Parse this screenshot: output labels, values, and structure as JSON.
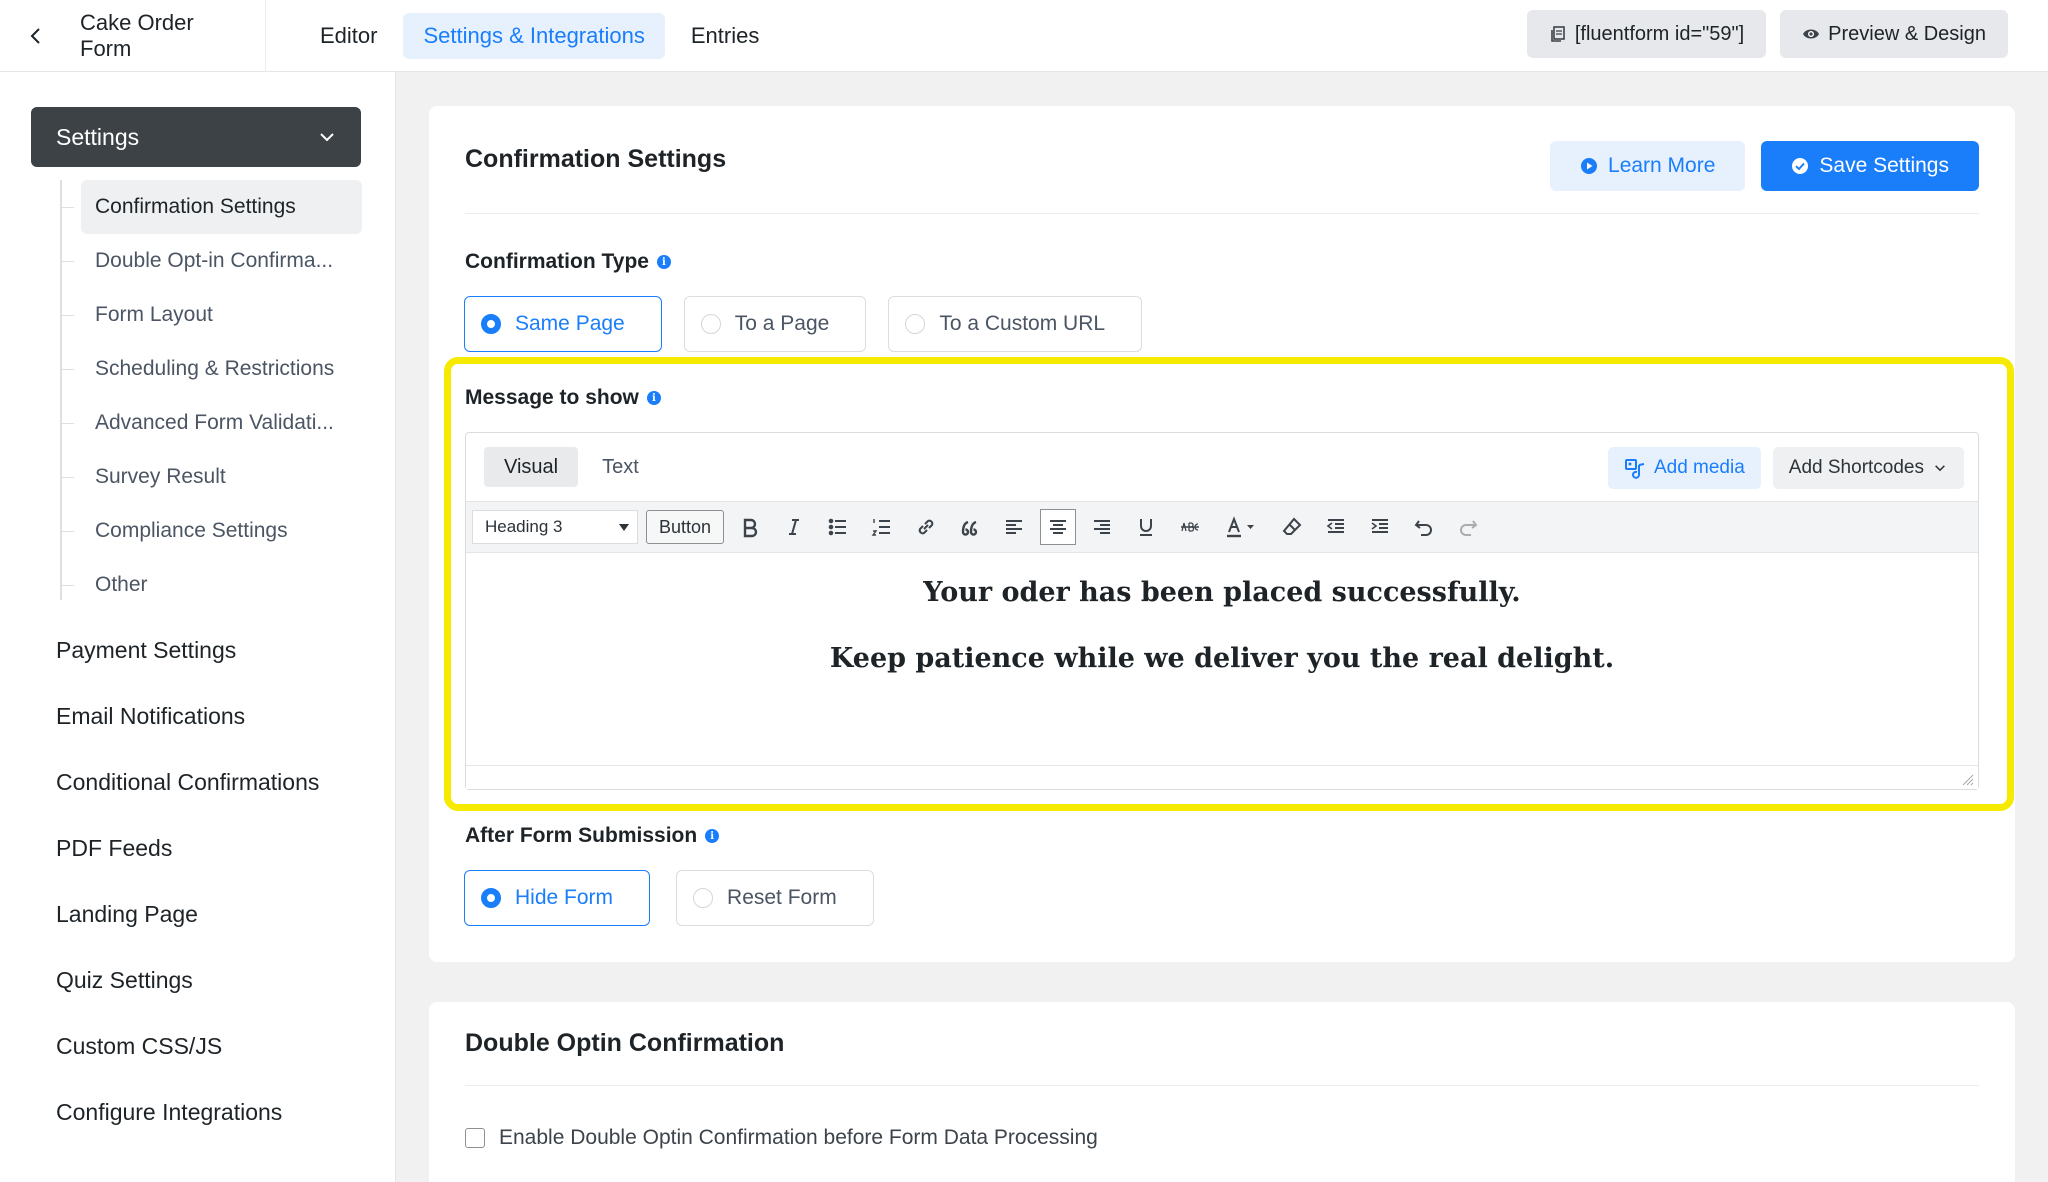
{
  "topbar": {
    "form_title": "Cake Order Form",
    "tabs": [
      {
        "label": "Editor"
      },
      {
        "label": "Settings & Integrations"
      },
      {
        "label": "Entries"
      }
    ],
    "shortcode_label": "[fluentform id=\"59\"]",
    "preview_label": "Preview & Design"
  },
  "sidebar": {
    "settings_label": "Settings",
    "sub_items": [
      {
        "label": "Confirmation Settings"
      },
      {
        "label": "Double Opt-in Confirma..."
      },
      {
        "label": "Form Layout"
      },
      {
        "label": "Scheduling & Restrictions"
      },
      {
        "label": "Advanced Form Validati..."
      },
      {
        "label": "Survey Result"
      },
      {
        "label": "Compliance Settings"
      },
      {
        "label": "Other"
      }
    ],
    "main_items": [
      {
        "label": "Payment Settings"
      },
      {
        "label": "Email Notifications"
      },
      {
        "label": "Conditional Confirmations"
      },
      {
        "label": "PDF Feeds"
      },
      {
        "label": "Landing Page"
      },
      {
        "label": "Quiz Settings"
      },
      {
        "label": "Custom CSS/JS"
      },
      {
        "label": "Configure Integrations"
      }
    ]
  },
  "confirmation": {
    "title": "Confirmation Settings",
    "learn_more_label": "Learn More",
    "save_label": "Save Settings",
    "type_label": "Confirmation Type",
    "type_options": [
      {
        "label": "Same Page"
      },
      {
        "label": "To a Page"
      },
      {
        "label": "To a Custom URL"
      }
    ],
    "message_label": "Message to show",
    "editor": {
      "tab_visual": "Visual",
      "tab_text": "Text",
      "add_media_label": "Add media",
      "add_shortcodes_label": "Add Shortcodes",
      "format_value": "Heading 3",
      "button_label": "Button",
      "lines": [
        "Your oder has been placed successfully.",
        "Keep patience while we deliver you the real delight."
      ]
    },
    "after_label": "After Form Submission",
    "after_options": [
      {
        "label": "Hide Form"
      },
      {
        "label": "Reset Form"
      }
    ]
  },
  "double_optin": {
    "title": "Double Optin Confirmation",
    "checkbox_label": "Enable Double Optin Confirmation before Form Data Processing"
  },
  "colors": {
    "accent": "#1a7efb",
    "highlight": "#f6ea00",
    "sidebar_head": "#3d4246"
  }
}
